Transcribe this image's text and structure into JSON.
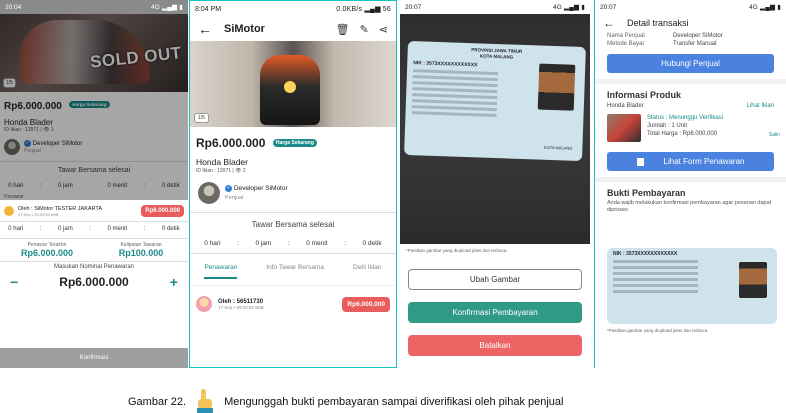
{
  "phone1": {
    "status_time": "20:04",
    "status_right": "4G ▂▄▆ ▮",
    "photo_counter": "1/5",
    "sold_label": "SOLD OUT",
    "price": "Rp6.000.000",
    "badge": "Harga Sekarang",
    "title": "Honda Blader",
    "meta": "ID Iklan : 13971 | 👁 1",
    "seller_name": "Developer SiMotor",
    "seller_role": "Penjual",
    "auction_done": "Tawar Bersama selesai",
    "countdown": [
      "0 hari",
      ":",
      "0 jam",
      ":",
      "0 menit",
      ":",
      "0 detik"
    ],
    "section_offers": "Penawar",
    "bidder_name": "Oleh : SiMotor TESTER JAKARTA",
    "bidder_time": "17 Sep • 20:03:54 WIB",
    "bidder_amount": "Rp6.000.000",
    "stat_left_label": "Penawar Terakhir",
    "stat_left_value": "Rp6.000.000",
    "stat_right_label": "Kelipatan Tawaran",
    "stat_right_value": "Rp100.000",
    "nominal_label": "Masukan Nominal Penawaran",
    "minus": "−",
    "nominal_value": "Rp6.000.000",
    "plus": "+",
    "confirm": "Konfirmasi"
  },
  "phone2": {
    "status_time": "8:04 PM",
    "status_right": "0.0KB/s ▂▄▆ 56",
    "app_title": "SiMotor",
    "photo_counter": "1/5",
    "price": "Rp6.000.000",
    "badge": "Harga Sekarang",
    "title": "Honda Blader",
    "meta": "ID Iklan : 13971 | 👁 2",
    "seller_name": "Developer SiMotor",
    "seller_role": "Penjual",
    "auction_done": "Tawar Bersama selesai",
    "countdown": [
      "0 hari",
      ":",
      "0 jam",
      ":",
      "0 menit",
      ":",
      "0 detik"
    ],
    "tabs": [
      "Penawaran",
      "Info Tawar Bersama",
      "Detil Iklan"
    ],
    "bidder_name": "Oleh : 56511730",
    "bidder_time": "17 Sep • 20:03:54 WIB",
    "bidder_amount": "Rp6.000.000"
  },
  "phone3": {
    "status_time": "20:07",
    "status_right": "4G ▂▄▆ ▮",
    "ktp_header_1": "PROVINSI JAWA TIMUR",
    "ktp_header_2": "KOTA MALANG",
    "ktp_nik": "NIK : 3573XXXXXXXXXXXX",
    "ktp_sign": "KOTA MALANG",
    "note": "*Pastikan gambar yang diupload jelas dan terbaca",
    "change_image": "Ubah Gambar",
    "confirm_payment": "Konfirmasi Pembayaran",
    "cancel": "Batalkan"
  },
  "phone4": {
    "status_time": "20:07",
    "status_right": "4G ▂▄▆ ▮",
    "title": "Detail transaksi",
    "seller_key": "Nama Penjual",
    "seller_val": "Developer SiMotor",
    "method_key": "Metode Bayar",
    "method_val": "Transfer Manual",
    "contact_button": "Hubungi Penjual",
    "product_heading": "Informasi Produk",
    "product_name": "Honda Blader",
    "see_ad": "Lihat Iklan",
    "status": "Status : Menunggu Verifikasi",
    "qty": "Jumlah : 1 Unit",
    "total": "Total Harga : Rp6.000.000",
    "copy": "Salin",
    "view_offer_form": "Lihat Form Penawaran",
    "proof_heading": "Bukti Pembayaran",
    "proof_desc": "Anda wajib melakukan konfirmasi pembayaran agar pesanan dapat diproses",
    "note": "*Pastikan gambar yang diupload jelas dan terbaca"
  },
  "caption": {
    "label": "Gambar 22.",
    "text": "Mengunggah bukti pembayaran sampai diverifikasi oleh pihak penjual"
  }
}
